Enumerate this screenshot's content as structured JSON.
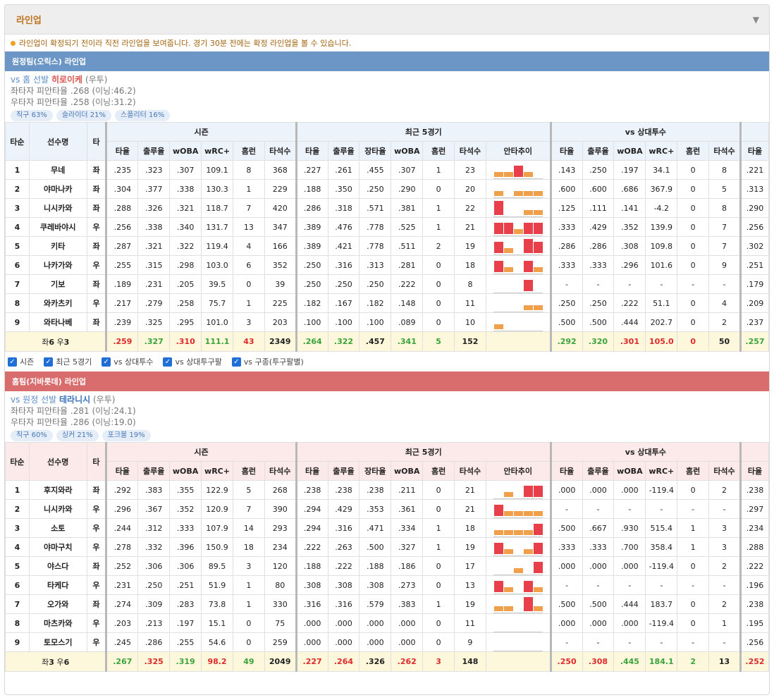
{
  "header": {
    "title": "라인업",
    "toggle_icon": "▼"
  },
  "notice": "라인업이 확정되기 전이라 직전 라인업을 보여줍니다. 경기 30분 전에는 확정 라인업을 볼 수 있습니다.",
  "columns": {
    "order": "타순",
    "name": "선수명",
    "hand": "타",
    "season": "시즌",
    "recent": "최근 5경기",
    "vs_pitcher": "vs 상대투수",
    "season_cols": [
      "타율",
      "출루율",
      "wOBA",
      "wRC+",
      "홈런",
      "타석수"
    ],
    "recent_cols": [
      "타율",
      "출루율",
      "장타율",
      "wOBA",
      "홈런",
      "타석수",
      "안타추이"
    ],
    "vs_cols": [
      "타율",
      "출루율",
      "wOBA",
      "wRC+",
      "홈런",
      "타석수"
    ],
    "extra_col": "타율"
  },
  "checkboxes": [
    "시즌",
    "최근 5경기",
    "vs 상대투수",
    "vs 상대투구팔",
    "vs 구종(투구팔별)"
  ],
  "colors": {
    "good": "#3ba33b",
    "bad": "#dd2b2b",
    "bar_high": "#e8404a",
    "bar_low": "#f0a04b",
    "away": "#6b96c6",
    "home": "#d96c6c"
  },
  "teams": [
    {
      "key": "away",
      "title": "원정팀(오릭스) 라인업",
      "pitcher": {
        "prefix": "vs 홈 선발",
        "name": "히로이케",
        "hand": "(우투)",
        "lhb": "좌타자 피안타율 .268 (이닝:46.2)",
        "rhb": "우타자 피안타율 .258 (이닝:31.2)",
        "tags": [
          "직구 63%",
          "슬라이더 21%",
          "스플리터 16%"
        ]
      },
      "rows": [
        {
          "o": "1",
          "n": "무네",
          "h": "좌",
          "s": [
            ".235",
            ".323",
            ".307",
            "109.1",
            "8",
            "368"
          ],
          "r": [
            ".227",
            ".261",
            ".455",
            ".307",
            "1",
            "23"
          ],
          "t": [
            1,
            1,
            3,
            1,
            0
          ],
          "v": [
            ".143",
            ".250",
            ".197",
            "34.1",
            "0",
            "8"
          ],
          "x": ".221"
        },
        {
          "o": "2",
          "n": "야마나카",
          "h": "좌",
          "s": [
            ".304",
            ".377",
            ".338",
            "130.3",
            "1",
            "229"
          ],
          "r": [
            ".188",
            ".350",
            ".250",
            ".290",
            "0",
            "20"
          ],
          "t": [
            1,
            0,
            1,
            1,
            1
          ],
          "v": [
            ".600",
            ".600",
            ".686",
            "367.9",
            "0",
            "5"
          ],
          "x": ".313"
        },
        {
          "o": "3",
          "n": "니시카와",
          "h": "좌",
          "s": [
            ".288",
            ".326",
            ".321",
            "118.7",
            "7",
            "420"
          ],
          "r": [
            ".286",
            ".318",
            ".571",
            ".381",
            "1",
            "22"
          ],
          "t": [
            4,
            0,
            0,
            1,
            1
          ],
          "v": [
            ".125",
            ".111",
            ".141",
            "-4.2",
            "0",
            "8"
          ],
          "x": ".290"
        },
        {
          "o": "4",
          "n": "쿠레바야시",
          "h": "우",
          "s": [
            ".256",
            ".338",
            ".340",
            "131.7",
            "13",
            "347"
          ],
          "r": [
            ".389",
            ".476",
            ".778",
            ".525",
            "1",
            "21"
          ],
          "t": [
            3,
            3,
            1,
            3,
            3
          ],
          "v": [
            ".333",
            ".429",
            ".352",
            "139.9",
            "0",
            "7"
          ],
          "x": ".256"
        },
        {
          "o": "5",
          "n": "키타",
          "h": "좌",
          "s": [
            ".287",
            ".321",
            ".322",
            "119.4",
            "4",
            "166"
          ],
          "r": [
            ".389",
            ".421",
            ".778",
            ".511",
            "2",
            "19"
          ],
          "t": [
            3,
            1,
            0,
            4,
            3
          ],
          "v": [
            ".286",
            ".286",
            ".308",
            "109.8",
            "0",
            "7"
          ],
          "x": ".302"
        },
        {
          "o": "6",
          "n": "나카가와",
          "h": "우",
          "s": [
            ".255",
            ".315",
            ".298",
            "103.0",
            "6",
            "352"
          ],
          "r": [
            ".250",
            ".316",
            ".313",
            ".281",
            "0",
            "18"
          ],
          "t": [
            3,
            1,
            0,
            3,
            1
          ],
          "v": [
            ".333",
            ".333",
            ".296",
            "101.6",
            "0",
            "9"
          ],
          "x": ".251"
        },
        {
          "o": "7",
          "n": "기보",
          "h": "좌",
          "s": [
            ".189",
            ".231",
            ".205",
            "39.5",
            "0",
            "39"
          ],
          "r": [
            ".250",
            ".250",
            ".250",
            ".222",
            "0",
            "8"
          ],
          "t": [
            0,
            0,
            0,
            3,
            0
          ],
          "v": [
            "-",
            "-",
            "-",
            "-",
            "-",
            "-"
          ],
          "x": ".179"
        },
        {
          "o": "8",
          "n": "와카츠키",
          "h": "우",
          "s": [
            ".217",
            ".279",
            ".258",
            "75.7",
            "1",
            "225"
          ],
          "r": [
            ".182",
            ".167",
            ".182",
            ".148",
            "0",
            "11"
          ],
          "t": [
            0,
            0,
            0,
            1,
            1
          ],
          "v": [
            ".250",
            ".250",
            ".222",
            "51.1",
            "0",
            "4"
          ],
          "x": ".209"
        },
        {
          "o": "9",
          "n": "와타나베",
          "h": "좌",
          "s": [
            ".239",
            ".325",
            ".295",
            "101.0",
            "3",
            "203"
          ],
          "r": [
            ".100",
            ".100",
            ".100",
            ".089",
            "0",
            "10"
          ],
          "t": [
            1,
            0,
            0,
            0,
            0
          ],
          "v": [
            ".500",
            ".500",
            ".444",
            "202.7",
            "0",
            "2"
          ],
          "x": ".237"
        }
      ],
      "total": {
        "label_pre": "좌",
        "label_l": "6",
        "label_mid": " 우",
        "label_r": "3",
        "s": [
          ".259",
          ".327",
          ".310",
          "111.1",
          "43",
          "2349"
        ],
        "sc": [
          "r",
          "g",
          "r",
          "g",
          "r",
          "k"
        ],
        "r": [
          ".264",
          ".322",
          ".457",
          ".341",
          "5",
          "152"
        ],
        "rc": [
          "g",
          "g",
          "k",
          "g",
          "g",
          "k"
        ],
        "v": [
          ".292",
          ".320",
          ".301",
          "105.0",
          "0",
          "50"
        ],
        "vc": [
          "g",
          "g",
          "r",
          "r",
          "r",
          "k"
        ],
        "x": ".257",
        "xc": "g"
      }
    },
    {
      "key": "home",
      "title": "홈팀(지바롯데) 라인업",
      "pitcher": {
        "prefix": "vs 원정 선발",
        "name": "테라니시",
        "hand": "(우투)",
        "lhb": "좌타자 피안타율 .281 (이닝:24.1)",
        "rhb": "우타자 피안타율 .286 (이닝:19.0)",
        "tags": [
          "직구 60%",
          "싱커 21%",
          "포크볼 19%"
        ]
      },
      "rows": [
        {
          "o": "1",
          "n": "후지와라",
          "h": "좌",
          "s": [
            ".292",
            ".383",
            ".355",
            "122.9",
            "5",
            "268"
          ],
          "r": [
            ".238",
            ".238",
            ".238",
            ".211",
            "0",
            "21"
          ],
          "t": [
            0,
            1,
            0,
            3,
            3
          ],
          "v": [
            ".000",
            ".000",
            ".000",
            "-119.4",
            "0",
            "2"
          ],
          "x": ".238"
        },
        {
          "o": "2",
          "n": "니시카와",
          "h": "우",
          "s": [
            ".296",
            ".367",
            ".352",
            "120.9",
            "7",
            "390"
          ],
          "r": [
            ".294",
            ".429",
            ".353",
            ".361",
            "0",
            "21"
          ],
          "t": [
            3,
            1,
            1,
            1,
            1
          ],
          "v": [
            "-",
            "-",
            "-",
            "-",
            "-",
            "-"
          ],
          "x": ".297"
        },
        {
          "o": "3",
          "n": "소토",
          "h": "우",
          "s": [
            ".244",
            ".312",
            ".333",
            "107.9",
            "14",
            "293"
          ],
          "r": [
            ".294",
            ".316",
            ".471",
            ".334",
            "1",
            "18"
          ],
          "t": [
            1,
            1,
            1,
            1,
            3
          ],
          "v": [
            ".500",
            ".667",
            ".930",
            "515.4",
            "1",
            "3"
          ],
          "x": ".234"
        },
        {
          "o": "4",
          "n": "야마구치",
          "h": "우",
          "s": [
            ".278",
            ".332",
            ".396",
            "150.9",
            "18",
            "234"
          ],
          "r": [
            ".222",
            ".263",
            ".500",
            ".327",
            "1",
            "19"
          ],
          "t": [
            3,
            1,
            0,
            1,
            3
          ],
          "v": [
            ".333",
            ".333",
            ".700",
            "358.4",
            "1",
            "3"
          ],
          "x": ".288"
        },
        {
          "o": "5",
          "n": "야스다",
          "h": "좌",
          "s": [
            ".252",
            ".306",
            ".306",
            "89.5",
            "3",
            "120"
          ],
          "r": [
            ".188",
            ".222",
            ".188",
            ".186",
            "0",
            "17"
          ],
          "t": [
            0,
            0,
            1,
            0,
            3
          ],
          "v": [
            ".000",
            ".000",
            ".000",
            "-119.4",
            "0",
            "2"
          ],
          "x": ".222"
        },
        {
          "o": "6",
          "n": "타케다",
          "h": "우",
          "s": [
            ".231",
            ".250",
            ".251",
            "51.9",
            "1",
            "80"
          ],
          "r": [
            ".308",
            ".308",
            ".308",
            ".273",
            "0",
            "13"
          ],
          "t": [
            3,
            1,
            0,
            3,
            1
          ],
          "v": [
            "-",
            "-",
            "-",
            "-",
            "-",
            "-"
          ],
          "x": ".196"
        },
        {
          "o": "7",
          "n": "오가와",
          "h": "좌",
          "s": [
            ".274",
            ".309",
            ".283",
            "73.8",
            "1",
            "330"
          ],
          "r": [
            ".316",
            ".316",
            ".579",
            ".383",
            "1",
            "19"
          ],
          "t": [
            1,
            1,
            0,
            4,
            1
          ],
          "v": [
            ".500",
            ".500",
            ".444",
            "183.7",
            "0",
            "2"
          ],
          "x": ".238"
        },
        {
          "o": "8",
          "n": "마츠카와",
          "h": "우",
          "s": [
            ".203",
            ".213",
            ".197",
            "15.1",
            "0",
            "75"
          ],
          "r": [
            ".000",
            ".000",
            ".000",
            ".000",
            "0",
            "11"
          ],
          "t": [
            0,
            0,
            0,
            0,
            0
          ],
          "v": [
            ".000",
            ".000",
            ".000",
            "-119.4",
            "0",
            "1"
          ],
          "x": ".195"
        },
        {
          "o": "9",
          "n": "토모스기",
          "h": "우",
          "s": [
            ".245",
            ".286",
            ".255",
            "54.6",
            "0",
            "259"
          ],
          "r": [
            ".000",
            ".000",
            ".000",
            ".000",
            "0",
            "9"
          ],
          "t": [
            0,
            0,
            0,
            0,
            0
          ],
          "v": [
            "-",
            "-",
            "-",
            "-",
            "-",
            "-"
          ],
          "x": ".256"
        }
      ],
      "total": {
        "label_pre": "좌",
        "label_l": "3",
        "label_mid": " 우",
        "label_r": "6",
        "s": [
          ".267",
          ".325",
          ".319",
          "98.2",
          "49",
          "2049"
        ],
        "sc": [
          "g",
          "r",
          "g",
          "r",
          "g",
          "k"
        ],
        "r": [
          ".227",
          ".264",
          ".326",
          ".262",
          "3",
          "148"
        ],
        "rc": [
          "r",
          "r",
          "k",
          "r",
          "r",
          "k"
        ],
        "v": [
          ".250",
          ".308",
          ".445",
          "184.1",
          "2",
          "13"
        ],
        "vc": [
          "r",
          "r",
          "g",
          "g",
          "g",
          "k"
        ],
        "x": ".252",
        "xc": "r"
      }
    }
  ]
}
